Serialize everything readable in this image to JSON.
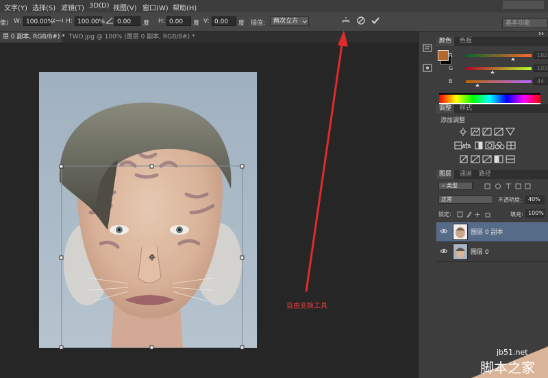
{
  "menu": {
    "items": [
      "文字(Y)",
      "选择(S)",
      "滤镜(T)",
      "3D(D)",
      "视图(V)",
      "窗口(W)",
      "帮助(H)"
    ]
  },
  "options": {
    "partial_label": "像)",
    "w_label": "W:",
    "w_value": "100.00%",
    "h_label": "H:",
    "h_value": "100.00%",
    "angle_value": "0.00",
    "angle_unit": "度",
    "hskew_label": "H:",
    "hskew_value": "0.00",
    "hskew_unit": "度",
    "vskew_label": "V:",
    "vskew_value": "0.00",
    "vskew_unit": "度",
    "interp_label": "插值:",
    "interp_value": "两次立方",
    "workspace_label": "基本功能"
  },
  "tabs": [
    {
      "label": "层 0 副本, RGB/8#) *",
      "active": true
    },
    {
      "label": "TWO.jpg @ 100% (图层 0 副本, RGB/8#) *",
      "active": false
    }
  ],
  "annotation": {
    "text": "自由变换工具",
    "color": "#e33b3b"
  },
  "color_panel": {
    "tabs": [
      "颜色",
      "色板"
    ],
    "foreground": "#b6672c",
    "background": "#000000",
    "channels": [
      {
        "label": "R",
        "value": "182",
        "fraction": 0.714
      },
      {
        "label": "G",
        "value": "103",
        "fraction": 0.404
      },
      {
        "label": "B",
        "value": "44",
        "fraction": 0.173
      }
    ]
  },
  "adjustments_panel": {
    "tabs": [
      "调整",
      "样式"
    ],
    "title": "添加调整"
  },
  "layers_panel": {
    "tabs": [
      "图层",
      "通道",
      "路径"
    ],
    "filter_kind": "类型",
    "blend_mode": "正常",
    "opacity_label": "不透明度:",
    "opacity_value": "40%",
    "lock_label": "锁定:",
    "fill_label": "填充:",
    "fill_value": "100%",
    "layers": [
      {
        "name": "图层 0 副本",
        "selected": true
      },
      {
        "name": "图层 0",
        "selected": false
      }
    ]
  },
  "watermark": {
    "url": "jb51.net",
    "name": "脚本之家"
  }
}
